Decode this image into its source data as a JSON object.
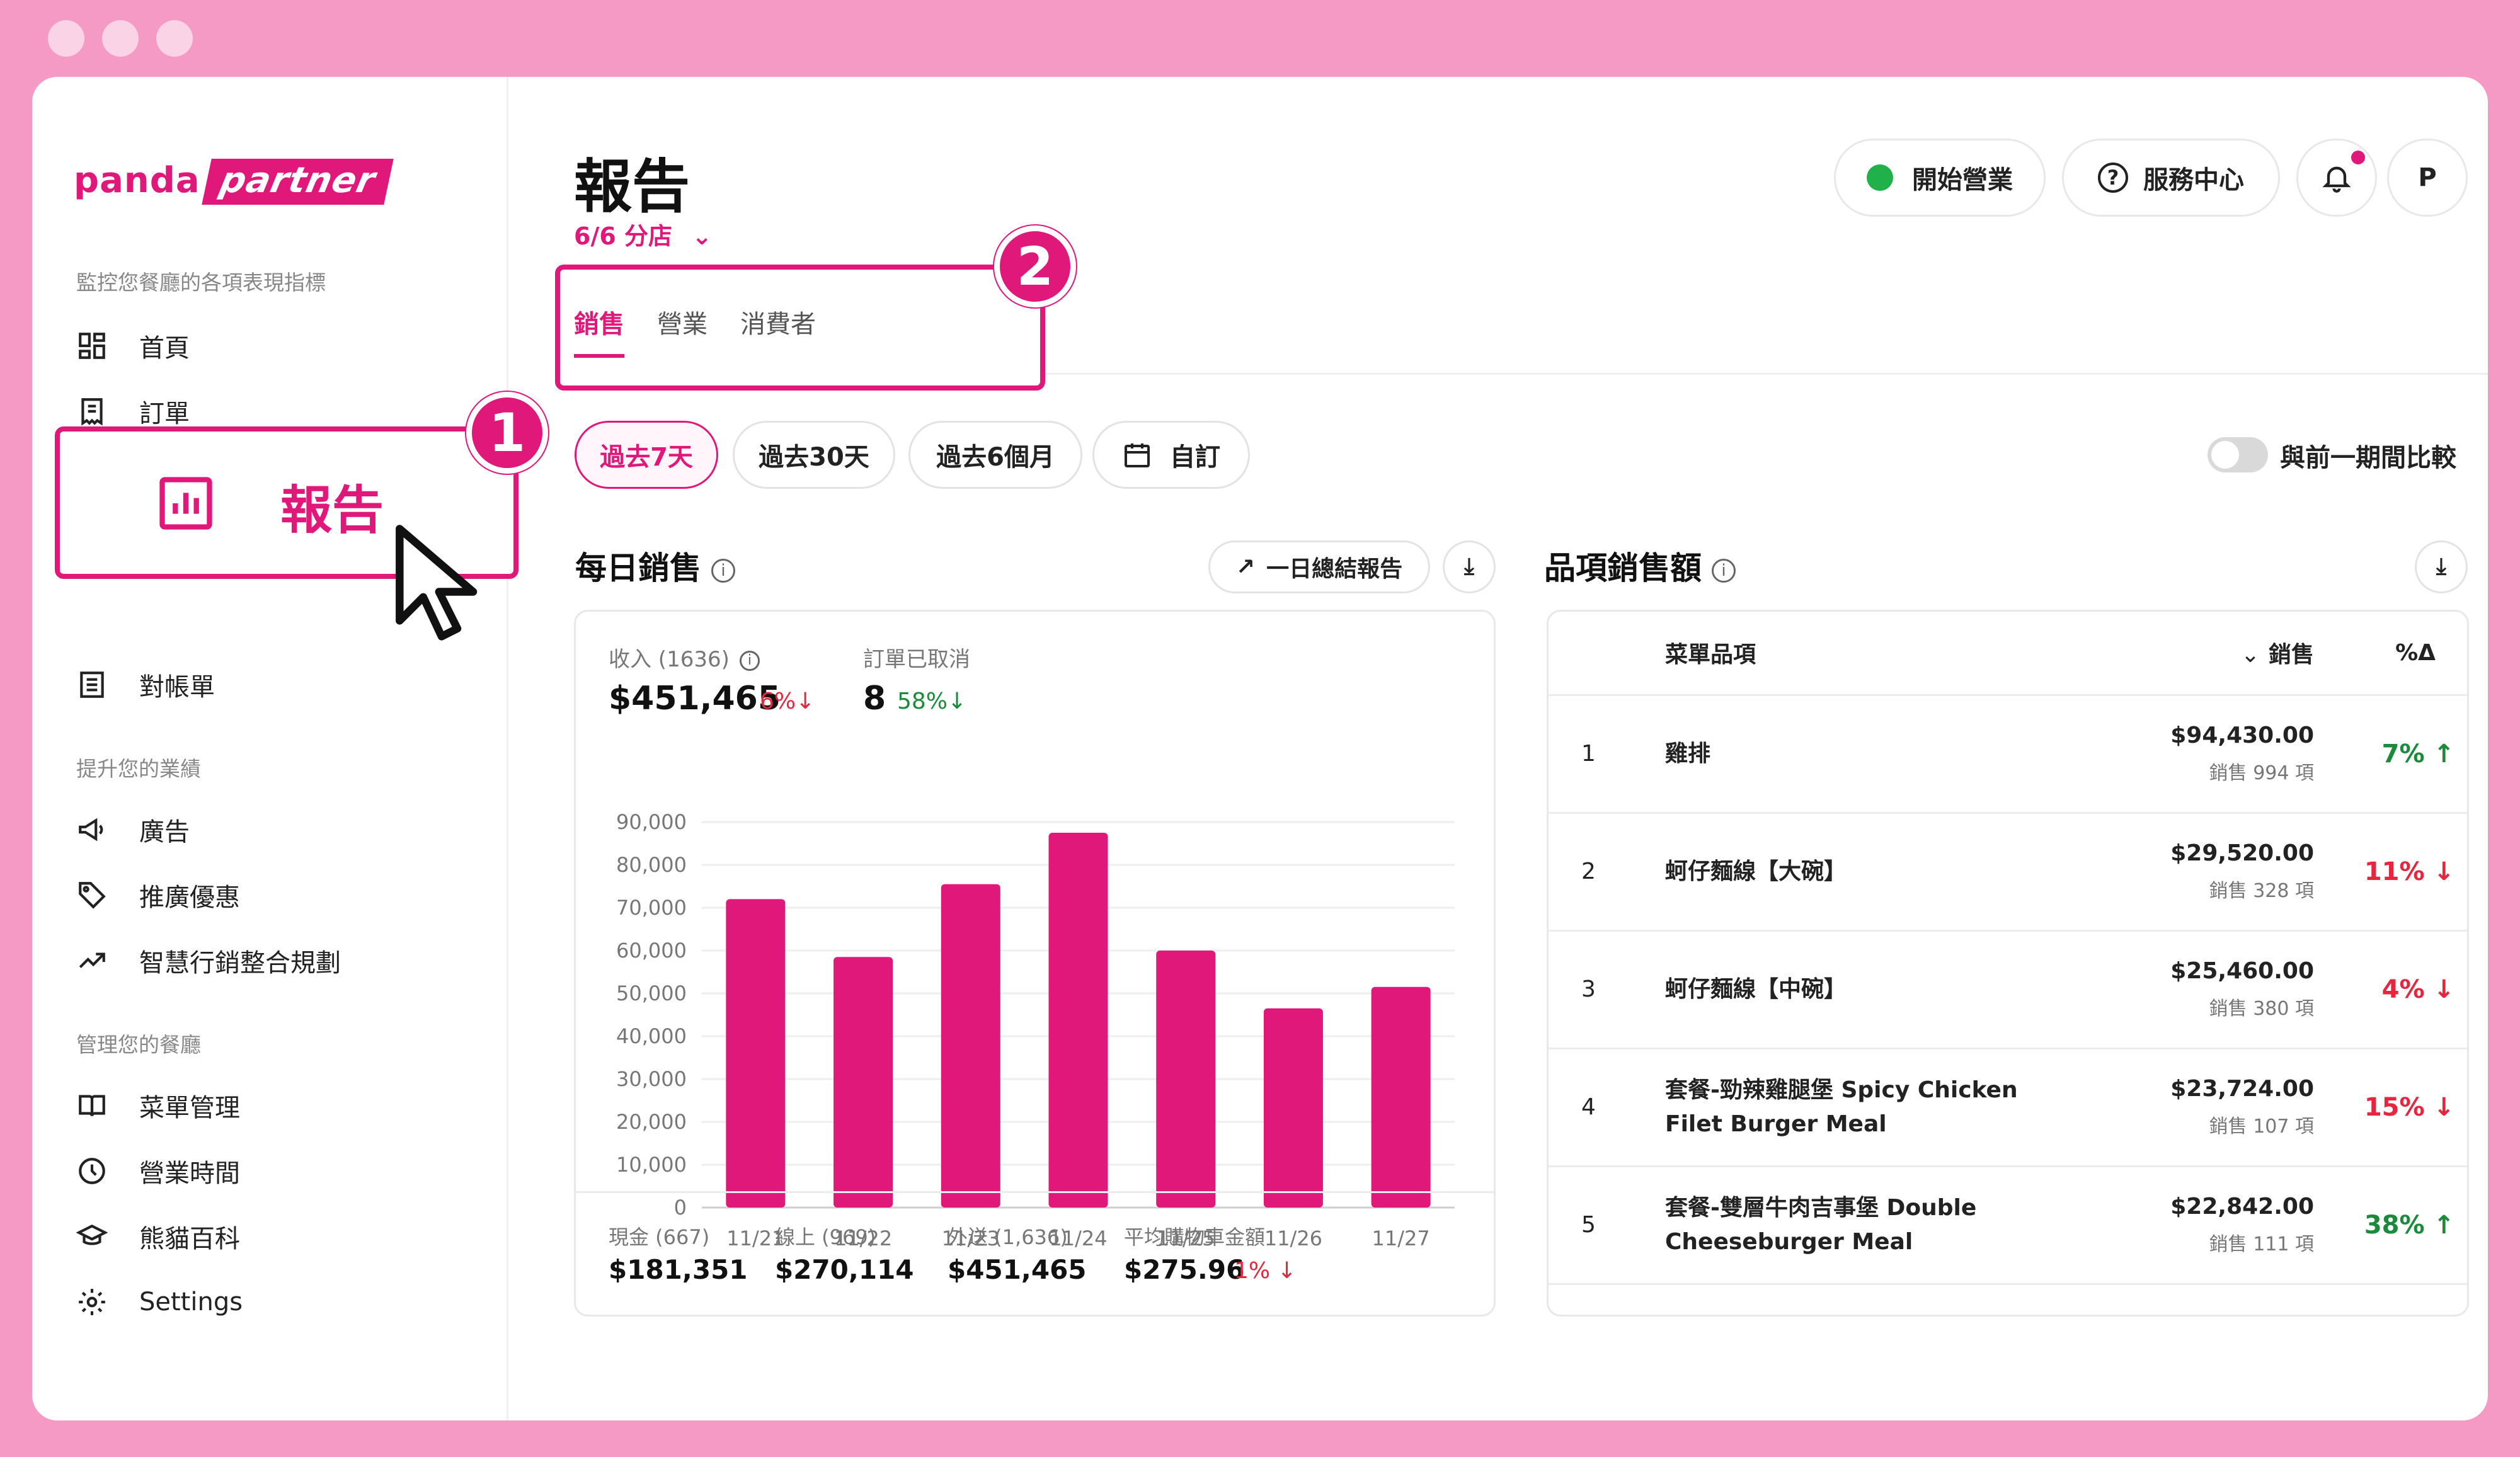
{
  "sidebar": {
    "logo_main": "panda",
    "logo_box": "partner",
    "section1": "監控您餐廳的各項表現指標",
    "home": "首頁",
    "orders": "訂單",
    "reports": "報告",
    "statements": "對帳單",
    "section2": "提升您的業績",
    "ads": "廣告",
    "promotions": "推廣優惠",
    "smart_marketing": "智慧行銷整合規劃",
    "section3": "管理您的餐廳",
    "menu": "菜單管理",
    "hours": "營業時間",
    "panda_wiki": "熊貓百科",
    "settings": "Settings"
  },
  "badges": {
    "one": "1",
    "two": "2"
  },
  "header": {
    "title": "報告",
    "branch": "6/6 分店",
    "open_label": "開始營業",
    "help_label": "服務中心",
    "avatar": "P"
  },
  "tabs": [
    "銷售",
    "營業",
    "消費者"
  ],
  "filters": {
    "last7": "過去7天",
    "last30": "過去30天",
    "last6m": "過去6個月",
    "custom": "自訂",
    "compare": "與前一期間比較"
  },
  "daily": {
    "title": "每日銷售",
    "summary_btn": "一日總結報告",
    "revenue_label": "收入 (1636)",
    "revenue_value": "$451,465",
    "revenue_delta": "6%",
    "cancelled_label": "訂單已取消",
    "cancelled_value": "8",
    "cancelled_delta": "58%",
    "footer": [
      {
        "label": "現金 (667)",
        "value": "$181,351"
      },
      {
        "label": "線上 (969)",
        "value": "$270,114"
      },
      {
        "label": "外送 (1,636)",
        "value": "$451,465"
      },
      {
        "label": "平均購物車金額",
        "value": "$275.96",
        "delta": "1%"
      }
    ]
  },
  "chart_data": {
    "type": "bar",
    "categories": [
      "11/21",
      "11/22",
      "11/23",
      "11/24",
      "11/25",
      "11/26",
      "11/27"
    ],
    "values": [
      72000,
      58500,
      75500,
      87500,
      60000,
      46500,
      51500
    ],
    "yticks": [
      "90,000",
      "80,000",
      "70,000",
      "60,000",
      "50,000",
      "40,000",
      "30,000",
      "20,000",
      "10,000",
      "0"
    ],
    "ylim": [
      0,
      90000
    ],
    "color": "#e0187a"
  },
  "items": {
    "title": "品項銷售額",
    "col_item": "菜單品項",
    "col_sales": "銷售",
    "col_pct": "%Δ",
    "rows": [
      {
        "rank": "1",
        "name": "雞排",
        "name2": "",
        "amount": "$94,430.00",
        "count": "銷售 994 項",
        "delta": "7%",
        "dir": "up"
      },
      {
        "rank": "2",
        "name": "蚵仔麵線【大碗】",
        "name2": "",
        "amount": "$29,520.00",
        "count": "銷售 328 項",
        "delta": "11%",
        "dir": "down"
      },
      {
        "rank": "3",
        "name": "蚵仔麵線【中碗】",
        "name2": "",
        "amount": "$25,460.00",
        "count": "銷售 380 項",
        "delta": "4%",
        "dir": "down"
      },
      {
        "rank": "4",
        "name": "套餐-勁辣雞腿堡 Spicy Chicken",
        "name2": "Filet Burger Meal",
        "amount": "$23,724.00",
        "count": "銷售 107 項",
        "delta": "15%",
        "dir": "down"
      },
      {
        "rank": "5",
        "name": "套餐-雙層牛肉吉事堡 Double",
        "name2": "Cheeseburger Meal",
        "amount": "$22,842.00",
        "count": "銷售 111 項",
        "delta": "38%",
        "dir": "up"
      }
    ]
  },
  "colors": {
    "accent": "#e0187a",
    "frame": "#f59ac4",
    "up": "#1b8a3a",
    "down": "#e5263e",
    "open_dot": "#20b14a"
  }
}
